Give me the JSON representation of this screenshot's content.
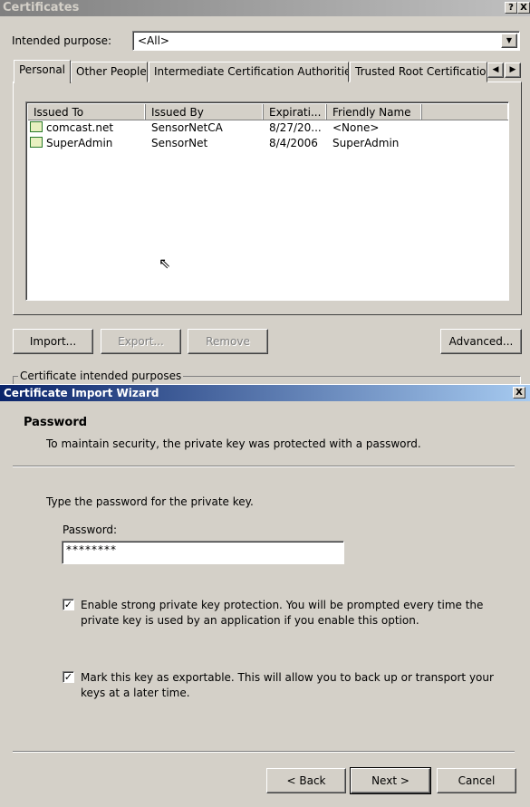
{
  "certificates": {
    "title": "Certificates",
    "help_btn": "?",
    "close_btn": "X",
    "intended_purpose_label": "Intended purpose:",
    "intended_purpose_value": "<All>",
    "tabs": [
      "Personal",
      "Other People",
      "Intermediate Certification Authorities",
      "Trusted Root Certification"
    ],
    "columns": [
      "Issued To",
      "Issued By",
      "Expirati...",
      "Friendly Name"
    ],
    "rows": [
      {
        "issued_to": "comcast.net",
        "issued_by": "SensorNetCA",
        "expiration": "8/27/20...",
        "friendly_name": "<None>"
      },
      {
        "issued_to": "SuperAdmin",
        "issued_by": "SensorNet",
        "expiration": "8/4/2006",
        "friendly_name": "SuperAdmin"
      }
    ],
    "buttons": {
      "import": "Import...",
      "export": "Export...",
      "remove": "Remove",
      "advanced": "Advanced..."
    },
    "purposes_group": "Certificate intended purposes"
  },
  "wizard": {
    "title": "Certificate Import Wizard",
    "close_btn": "X",
    "heading": "Password",
    "subheading": "To maintain security, the private key was protected with a password.",
    "instruction": "Type the password for the private key.",
    "password_label": "Password:",
    "password_value": "********",
    "option1": {
      "checked": true,
      "line1": "Enable strong private key protection. You will be prompted every time the",
      "line2": "private key is used by an application if you enable this option."
    },
    "option2": {
      "checked": true,
      "line1": "Mark this key as exportable. This will allow you to back up or transport your",
      "line2": "keys at a later time."
    },
    "check_mark": "✓",
    "buttons": {
      "back": "< Back",
      "next": "Next >",
      "cancel": "Cancel"
    }
  }
}
